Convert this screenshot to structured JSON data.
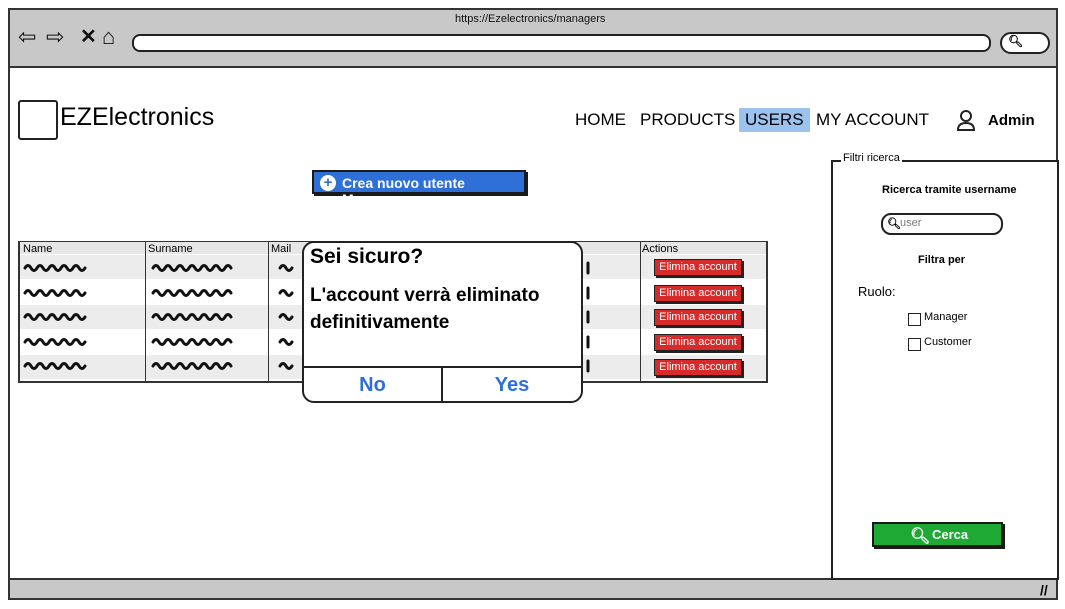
{
  "browser": {
    "url": "https://Ezelectronics/managers"
  },
  "header": {
    "brand": "EZElectronics",
    "nav": [
      "HOME",
      "PRODUCTS",
      "USERS",
      "MY ACCOUNT"
    ],
    "active_nav": "USERS",
    "user": "Admin"
  },
  "main": {
    "create_button": "Crea nuovo utente Manager",
    "table": {
      "columns": [
        "Name",
        "Surname",
        "Mail",
        "Actions"
      ],
      "row_action": "Elimina account",
      "rows": 5
    }
  },
  "modal": {
    "title": "Sei sicuro?",
    "message": "L'account verrà eliminato definitivamente",
    "no_label": "No",
    "yes_label": "Yes"
  },
  "filters": {
    "legend": "Filtri ricerca",
    "search_title": "Ricerca tramite username",
    "search_placeholder": "user",
    "filter_by": "Filtra per",
    "role_label": "Ruolo:",
    "roles": [
      "Manager",
      "Customer"
    ],
    "search_button": "Cerca"
  },
  "colors": {
    "primary": "#2f6fd8",
    "danger": "#d62b2b",
    "success": "#1ea834",
    "active_nav": "#9cc2f0"
  }
}
